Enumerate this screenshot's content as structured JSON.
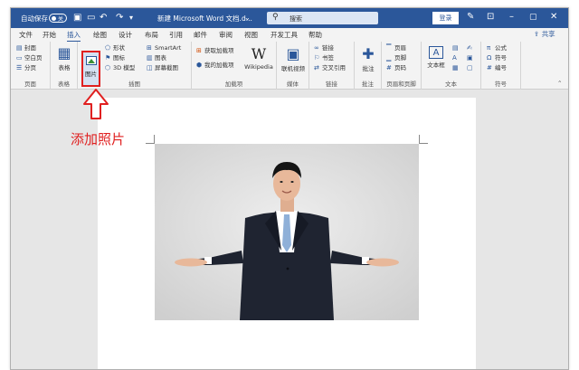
{
  "title_bar": {
    "autosave_label": "自动保存",
    "toggle_state": "关",
    "title": "新建 Microsoft Word 文档.d...",
    "search_placeholder": "搜索",
    "login_label": "登录"
  },
  "tabs": [
    "文件",
    "开始",
    "插入",
    "绘图",
    "设计",
    "布局",
    "引用",
    "邮件",
    "审阅",
    "视图",
    "开发工具",
    "帮助"
  ],
  "active_tab": "插入",
  "share_label": "共享",
  "ribbon": {
    "pages": {
      "items": [
        "封面",
        "空白页",
        "分页"
      ],
      "group": "页面"
    },
    "tables": {
      "button": "表格",
      "group": "表格"
    },
    "illustrations": {
      "pictures": "图片",
      "items": [
        "形状",
        "图标",
        "3D 模型",
        "SmartArt",
        "图表",
        "屏幕截图"
      ],
      "group": "插图"
    },
    "addins": {
      "items": [
        "获取加载项",
        "我的加载项"
      ],
      "wikipedia": "Wikipedia",
      "group": "加载项"
    },
    "media": {
      "button": "联机视频",
      "group": "媒体"
    },
    "links": {
      "items": [
        "链接",
        "书签",
        "交叉引用"
      ],
      "group": "链接"
    },
    "comments": {
      "button": "批注",
      "group": "批注"
    },
    "header_footer": {
      "items": [
        "页眉",
        "页脚",
        "页码"
      ],
      "group": "页眉和页脚"
    },
    "text": {
      "button": "文本框",
      "group": "文本"
    },
    "symbols": {
      "items": [
        "公式",
        "符号",
        "编号"
      ],
      "group": "符号"
    }
  },
  "annotation": "添加照片",
  "colors": {
    "accent": "#2b579a",
    "highlight": "#e02020"
  }
}
